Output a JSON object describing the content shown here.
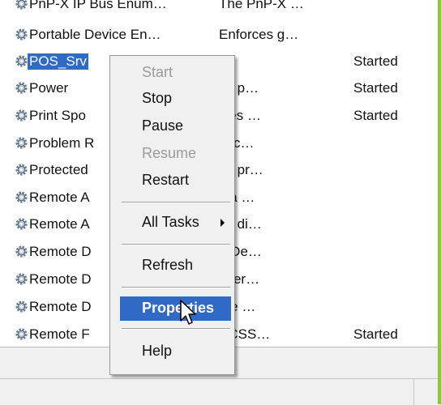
{
  "services": [
    {
      "name": "PnP-X IP Bus Enum…",
      "description": "The PnP-X …",
      "status": ""
    },
    {
      "name": "Portable Device En…",
      "description": "Enforces g…",
      "status": ""
    },
    {
      "name": "POS_Srv",
      "description": "",
      "status": "Started",
      "selected": true
    },
    {
      "name": "Power",
      "description": "es p…",
      "status": "Started"
    },
    {
      "name": "Print Spo",
      "description": "files …",
      "status": "Started"
    },
    {
      "name": "Problem R",
      "description": "rvic…",
      "status": ""
    },
    {
      "name": "Protected",
      "description": "es pr…",
      "status": ""
    },
    {
      "name": "Remote A",
      "description": "s a …",
      "status": ""
    },
    {
      "name": "Remote A",
      "description": "es di…",
      "status": ""
    },
    {
      "name": "Remote D",
      "description": "e De…",
      "status": ""
    },
    {
      "name": "Remote D",
      "description": "user…",
      "status": ""
    },
    {
      "name": "Remote D",
      "description": "the …",
      "status": ""
    },
    {
      "name": "Remote F",
      "description": "PCSS…",
      "status": "Started"
    }
  ],
  "menu": {
    "items": [
      {
        "label": "Start",
        "disabled": true
      },
      {
        "label": "Stop",
        "disabled": false
      },
      {
        "label": "Pause",
        "disabled": false
      },
      {
        "label": "Resume",
        "disabled": true
      },
      {
        "label": "Restart",
        "disabled": false
      },
      {
        "label": "All Tasks",
        "disabled": false,
        "submenu": true
      },
      {
        "label": "Refresh",
        "disabled": false
      },
      {
        "label": "Properties",
        "disabled": false,
        "highlighted": true
      },
      {
        "label": "Help",
        "disabled": false
      }
    ]
  },
  "colors": {
    "selection": "#3169c6",
    "frame_accent": "#8dc63f",
    "disabled_text": "#9b9b9b"
  },
  "icons": {
    "service": "gear-icon",
    "cursor": "mouse-pointer-icon",
    "submenu": "submenu-arrow-icon"
  }
}
